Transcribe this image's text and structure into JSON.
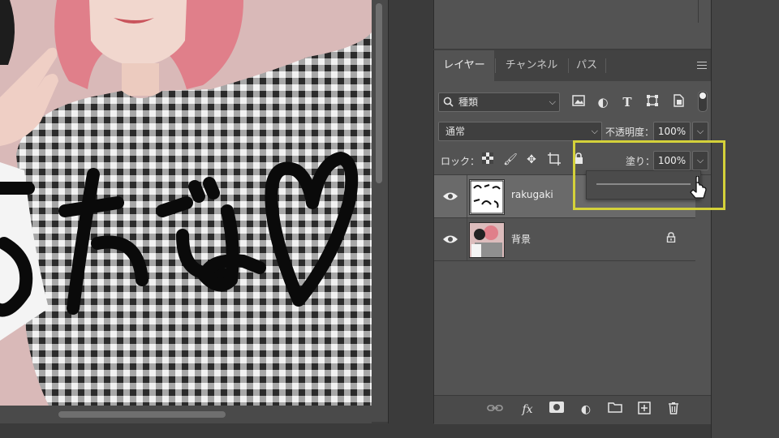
{
  "panel": {
    "tabs": [
      {
        "label": "レイヤー",
        "active": true
      },
      {
        "label": "チャンネル",
        "active": false
      },
      {
        "label": "パス",
        "active": false
      }
    ],
    "filter": {
      "label": "種類",
      "icons": [
        "image-filter-icon",
        "adjustment-filter-icon",
        "type-filter-icon",
        "shape-filter-icon",
        "smart-object-filter-icon"
      ]
    },
    "blend_mode": "通常",
    "opacity_label": "不透明度：",
    "opacity_value": "100%",
    "lock_label": "ロック：",
    "fill_label": "塗り：",
    "fill_value": "100%",
    "fill_slider_value": 1.0,
    "layers": [
      {
        "name": "rakugaki",
        "visible": true,
        "selected": true
      },
      {
        "name": "背景",
        "visible": true,
        "locked": true
      }
    ]
  },
  "canvas": {
    "overlay_text": "友だよ♡"
  },
  "colors": {
    "panel_bg": "#535353",
    "selected_row": "#6a6a6a",
    "highlight": "#d4d13a"
  }
}
